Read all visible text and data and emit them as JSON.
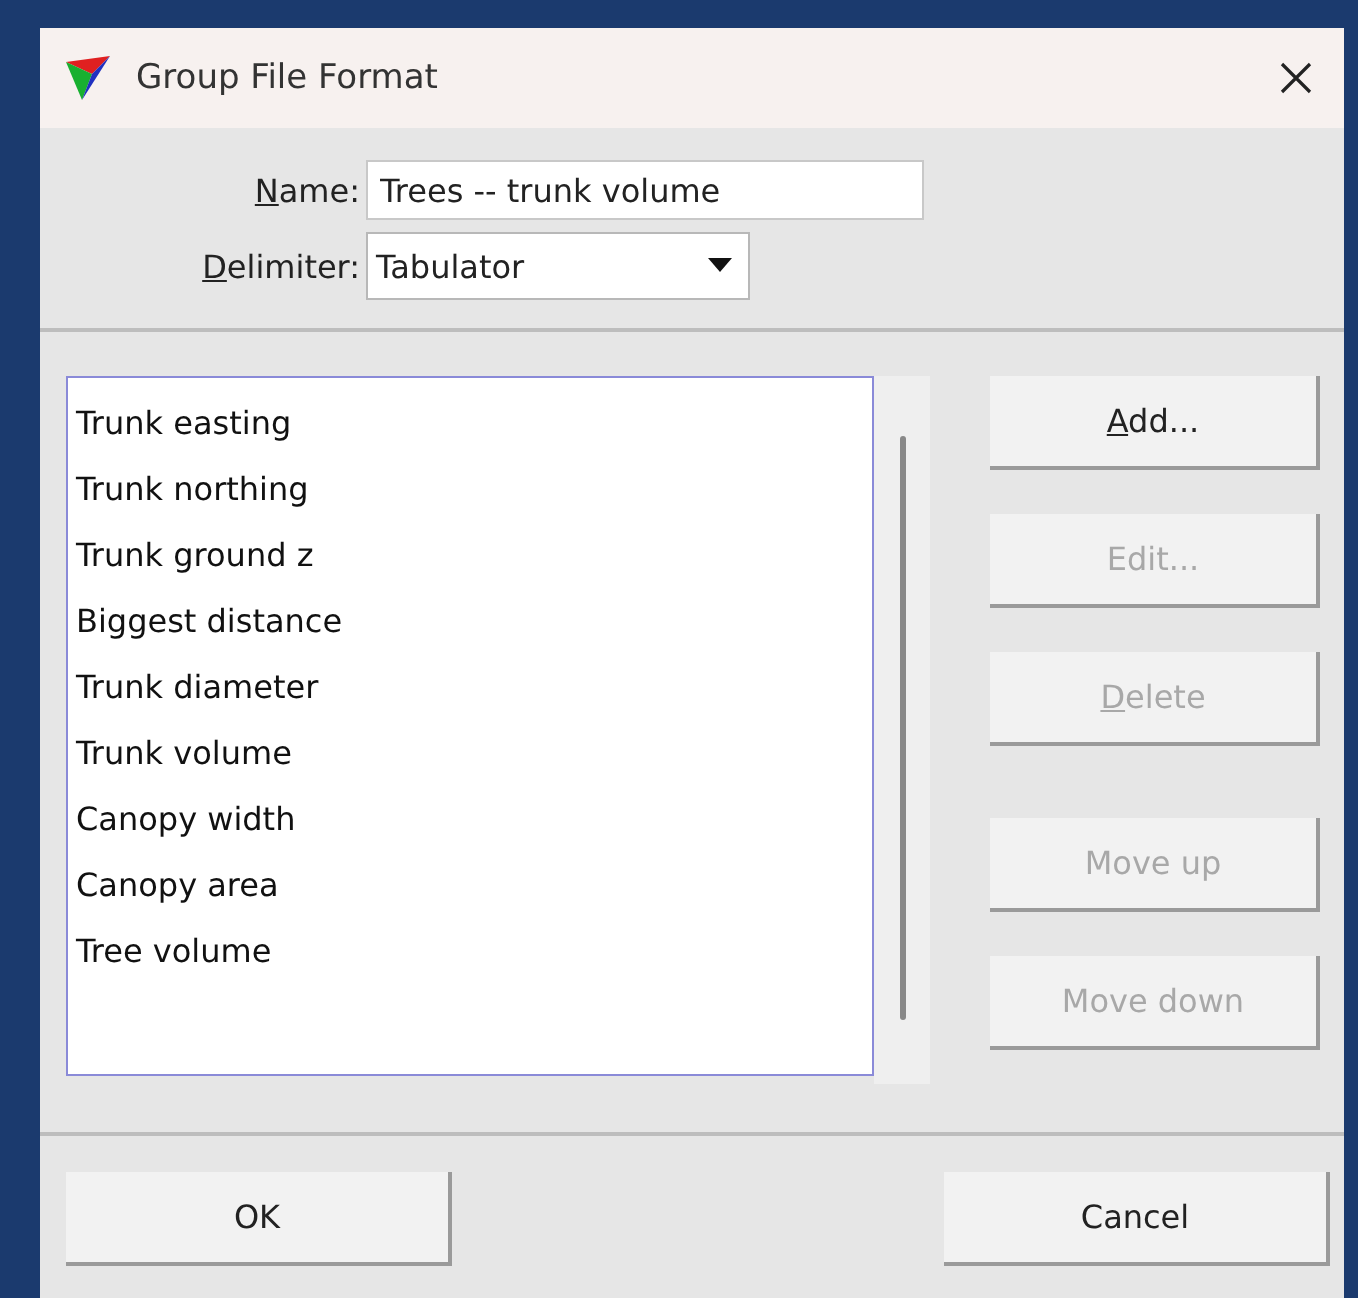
{
  "window": {
    "title": "Group File Format"
  },
  "fields": [
    {
      "kind": "text",
      "label": "Name:",
      "underline_first": true,
      "value": "Trees -- trunk volume"
    },
    {
      "kind": "combo",
      "label": "Delimiter:",
      "underline_first": true,
      "value": "Tabulator"
    }
  ],
  "list": {
    "items": [
      {
        "label": "Trunk easting",
        "selected": false
      },
      {
        "label": "Trunk northing",
        "selected": false
      },
      {
        "label": "Trunk ground z",
        "selected": false
      },
      {
        "label": "Biggest distance",
        "selected": false
      },
      {
        "label": "Trunk diameter",
        "selected": false
      },
      {
        "label": "Trunk volume",
        "selected": false
      },
      {
        "label": "Canopy width",
        "selected": false
      },
      {
        "label": "Canopy area",
        "selected": false
      },
      {
        "label": "Tree volume",
        "selected": false
      }
    ]
  },
  "side_buttons": [
    {
      "label": "Add...",
      "disabled": false,
      "underline_first": true
    },
    {
      "label": "Edit...",
      "disabled": true,
      "underline_first": false
    },
    {
      "label": "Delete",
      "disabled": true,
      "underline_first": true
    },
    {
      "label": "Move up",
      "disabled": true,
      "underline_first": false
    },
    {
      "label": "Move down",
      "disabled": true,
      "underline_first": false
    }
  ],
  "footer_buttons": [
    {
      "label": "OK",
      "disabled": false
    },
    {
      "label": "Cancel",
      "disabled": false
    }
  ]
}
